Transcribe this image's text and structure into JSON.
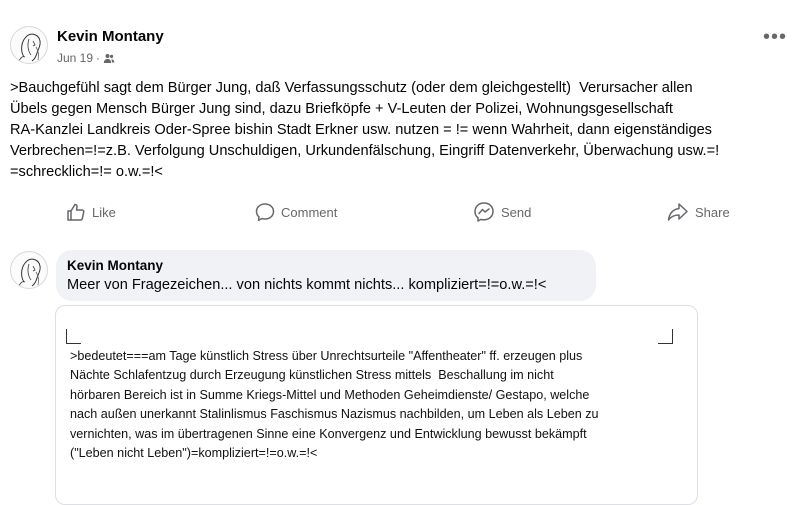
{
  "post": {
    "author": "Kevin Montany",
    "date": "Jun 19",
    "separator": "·",
    "audience_icon": "friends-icon",
    "text": ">Bauchgefühl sagt dem Bürger Jung, daß Verfassungsschutz (oder dem gleichgestellt)  Verursacher allen\nÜbels gegen Mensch Bürger Jung sind, dazu Briefköpfe + V-Leuten der Polizei, Wohnungsgesellschaft\nRA-Kanzlei Landkreis Oder-Spree bishin Stadt Erkner usw. nutzen = != wenn Wahrheit, dann eigenständiges\nVerbrechen=!=z.B. Verfolgung Unschuldigen, Urkundenfälschung, Eingriff Datenverkehr, Überwachung usw.=!\n=schrecklich=!= o.w.=!<"
  },
  "actions": {
    "like": "Like",
    "comment": "Comment",
    "send": "Send",
    "share": "Share"
  },
  "comment": {
    "author": "Kevin Montany",
    "text": "Meer von Fragezeichen... von nichts kommt nichts... kompliziert=!=o.w.=!<",
    "attachment_text": ">bedeutet===am Tage künstlich Stress über Unrechtsurteile \"Affentheater\" ff. erzeugen plus\nNächte Schlafentzug durch Erzeugung künstlichen Stress mittels  Beschallung im nicht\nhörbaren Bereich ist in Summe Kriegs-Mittel und Methoden Geheimdienste/ Gestapo, welche\nnach außen unerkannt Stalinlismus Faschismus Nazismus nachbilden, um Leben als Leben zu\nvernichten, was im übertragenen Sinne eine Konvergenz und Entwicklung bewusst bekämpft\n(\"Leben nicht Leben\")=kompliziert=!=o.w.=!<"
  },
  "colors": {
    "secondary_text": "#65676b",
    "bubble_bg": "#f0f2f5"
  }
}
